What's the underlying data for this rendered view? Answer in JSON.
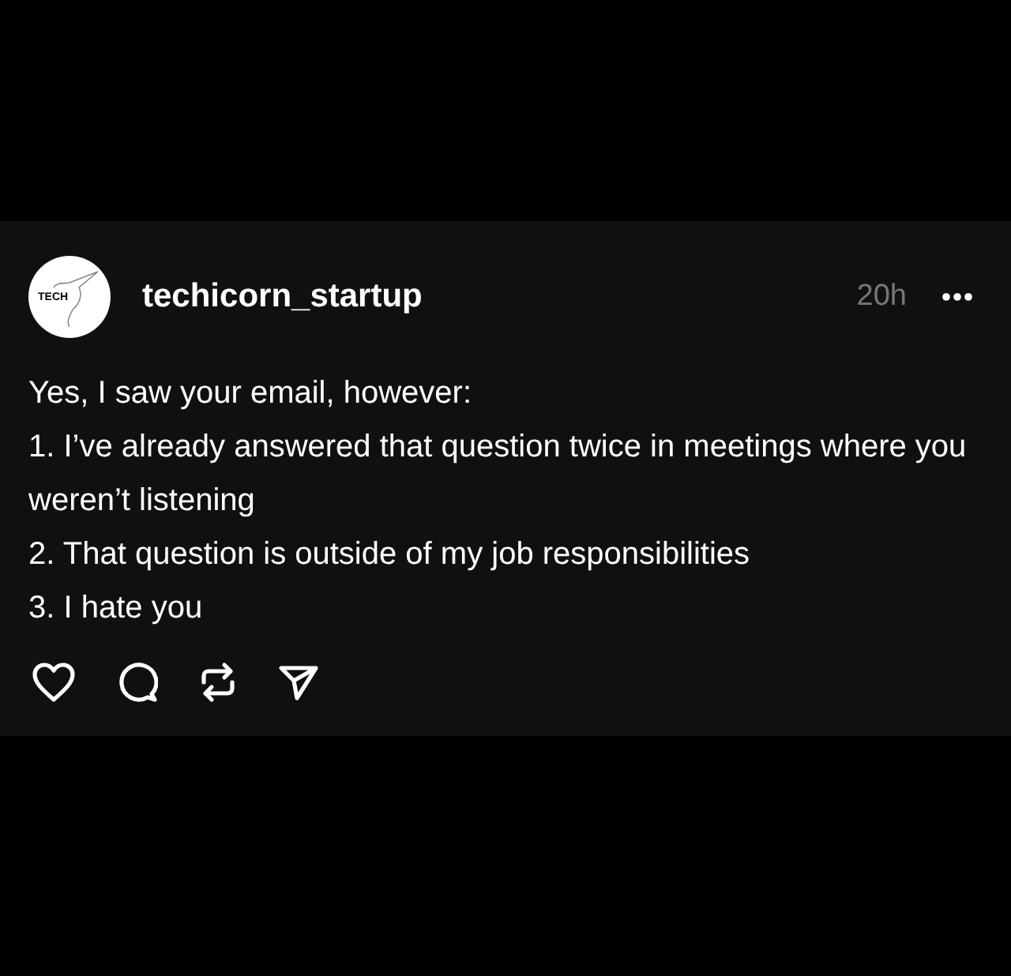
{
  "post": {
    "avatar_text": "TECH",
    "username": "techicorn_startup",
    "time": "20h",
    "lines": [
      "Yes, I saw your email, however:",
      "1. I’ve already answered that question twice in meetings where you weren’t listening",
      "2. That question is outside of my job responsibilities",
      "3. I hate you"
    ],
    "actions": [
      {
        "kind": "like"
      },
      {
        "kind": "comment"
      },
      {
        "kind": "repost"
      },
      {
        "kind": "share"
      }
    ]
  }
}
